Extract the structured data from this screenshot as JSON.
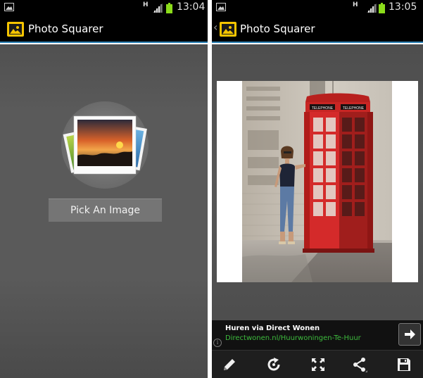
{
  "left": {
    "status": {
      "time": "13:04",
      "network": "H"
    },
    "app": {
      "title": "Photo Squarer"
    },
    "pick_button": {
      "label": "Pick An Image"
    }
  },
  "right": {
    "status": {
      "time": "13:05",
      "network": "H"
    },
    "app": {
      "title": "Photo Squarer"
    },
    "ad": {
      "title": "Huren via Direct Wonen",
      "url": "Directwonen.nl/Huurwoningen-Te-Huur",
      "info": "i"
    },
    "toolbar": [
      "pencil-icon",
      "rotate-icon",
      "fit-icon",
      "share-icon",
      "save-icon"
    ]
  },
  "colors": {
    "accent": "#2a7fb3",
    "ad_url": "#3dbb3d",
    "booth_red": "#d42a2a"
  }
}
